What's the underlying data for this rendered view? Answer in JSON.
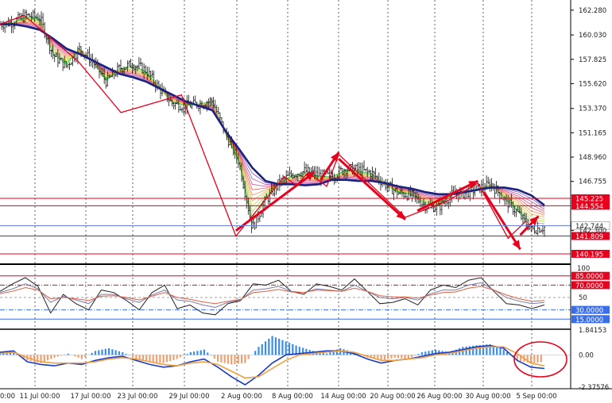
{
  "chart_data": [
    {
      "panel": "price",
      "type": "candlestick",
      "ylim": [
        139.4,
        163.2
      ],
      "y_ticks": [
        "162.280",
        "160.030",
        "157.825",
        "155.620",
        "153.370",
        "151.165",
        "148.960",
        "146.755",
        "142.300"
      ],
      "horizontal_levels": [
        {
          "label": "145.225",
          "value": 145.225,
          "color": "#e8001c",
          "style": "solid"
        },
        {
          "label": "144.554",
          "value": 144.554,
          "color": "#e8001c",
          "style": "solid"
        },
        {
          "label": "141.809",
          "value": 141.809,
          "color": "#e8001c",
          "style": "solid"
        },
        {
          "label": "140.195",
          "value": 140.195,
          "color": "#e8001c",
          "style": "solid"
        }
      ],
      "current_price": {
        "label": "142.744",
        "value": 142.744,
        "color": "#6d7fd6"
      },
      "close_path": [
        161,
        161.2,
        161.8,
        161.6,
        158.2,
        157.2,
        158.8,
        157.6,
        155.8,
        157,
        157.4,
        156.8,
        155.2,
        153.8,
        153.6,
        153.8,
        154.1,
        151,
        148.5,
        142.5,
        145,
        146.6,
        147.4,
        147.7,
        147.3,
        147.2,
        147.9,
        147.8,
        147.5,
        146.5,
        145.7,
        145.5,
        144.6,
        144.4,
        145.5,
        145.7,
        146.1,
        146.5,
        145.1,
        143.9,
        142.4,
        142.6
      ],
      "ma_path": [
        161,
        161,
        160.8,
        160.5,
        159.7,
        158.8,
        158.3,
        157.7,
        157.1,
        156.5,
        156.2,
        155.8,
        155.2,
        154.6,
        154,
        153.6,
        153.2,
        151.3,
        149.7,
        148,
        146.8,
        146.5,
        146.5,
        146.4,
        146.5,
        146.9,
        146.9,
        146.8,
        146.8,
        146.6,
        146.3,
        146.1,
        145.8,
        145.6,
        145.6,
        145.8,
        146,
        146.2,
        146.2,
        146,
        145.5,
        144.6
      ],
      "zigzag": [
        [
          0,
          161
        ],
        [
          4,
          161.8
        ],
        [
          13,
          157.6
        ],
        [
          20,
          153
        ],
        [
          30,
          154.6
        ],
        [
          39,
          141.8
        ],
        [
          47,
          147.2
        ],
        [
          49,
          146.4
        ],
        [
          51,
          147.6
        ],
        [
          54,
          146.3
        ],
        [
          56,
          149.2
        ],
        [
          67,
          143.5
        ],
        [
          74,
          145
        ],
        [
          79,
          146.6
        ],
        [
          84,
          141.6
        ],
        [
          87,
          143.2
        ]
      ],
      "trend_arrows": [
        {
          "from": [
            39,
            142.3
          ],
          "to": [
            52,
            147.6
          ]
        },
        {
          "from": [
            53,
            146.9
          ],
          "to": [
            56,
            149.4
          ]
        },
        {
          "from": [
            56,
            148.8
          ],
          "to": [
            67,
            143.3
          ]
        },
        {
          "from": [
            69,
            144.1
          ],
          "to": [
            79,
            146.8
          ]
        },
        {
          "from": [
            80,
            145.8
          ],
          "to": [
            86,
            140.6
          ]
        },
        {
          "from": [
            86,
            141.9
          ],
          "to": [
            89,
            143.6
          ]
        }
      ]
    },
    {
      "panel": "rsi",
      "type": "line",
      "ylim": [
        0,
        100
      ],
      "y_ticks": [
        "100"
      ],
      "levels": [
        {
          "label": "85.0000",
          "value": 85,
          "color": "#e8001c",
          "style": "solid"
        },
        {
          "label": "70.0000",
          "value": 70,
          "color": "#e8001c",
          "style": "dashdot"
        },
        {
          "label": "50",
          "value": 50,
          "color": "#a0a0a0",
          "style": "dashed"
        },
        {
          "label": "30.0000",
          "value": 30,
          "color": "#3a6ee8",
          "style": "dashdot"
        },
        {
          "label": "15.0000",
          "value": 15,
          "color": "#3a6ee8",
          "style": "solid"
        }
      ],
      "series": [
        {
          "values": [
            60,
            72,
            82,
            68,
            25,
            55,
            40,
            30,
            62,
            58,
            45,
            30,
            58,
            70,
            32,
            38,
            25,
            22,
            40,
            45,
            72,
            70,
            78,
            60,
            55,
            72,
            68,
            62,
            80,
            60,
            40,
            42,
            48,
            38,
            62,
            70,
            66,
            78,
            82,
            60,
            40,
            38,
            32,
            38
          ],
          "color": "#222222"
        },
        {
          "values": [
            58,
            64,
            72,
            64,
            42,
            52,
            46,
            40,
            55,
            55,
            48,
            42,
            54,
            62,
            46,
            44,
            38,
            34,
            42,
            46,
            62,
            64,
            68,
            60,
            58,
            64,
            62,
            60,
            70,
            60,
            50,
            48,
            50,
            46,
            56,
            62,
            62,
            70,
            74,
            62,
            50,
            44,
            40,
            42
          ],
          "color": "#7a7aa8"
        },
        {
          "values": [
            56,
            60,
            66,
            62,
            48,
            50,
            48,
            45,
            52,
            53,
            50,
            46,
            52,
            58,
            50,
            47,
            43,
            40,
            44,
            47,
            58,
            60,
            63,
            59,
            58,
            62,
            61,
            60,
            65,
            60,
            53,
            51,
            51,
            49,
            54,
            58,
            59,
            65,
            68,
            62,
            54,
            48,
            44,
            45
          ],
          "color": "#e06040"
        }
      ]
    },
    {
      "panel": "macd",
      "type": "bar+line",
      "ylim": [
        -2.37576,
        1.84153
      ],
      "y_ticks": [
        "1.84153",
        "0.00",
        "-2.37576"
      ],
      "histogram": [
        0.2,
        0.3,
        -0.4,
        -0.6,
        -0.2,
        0.1,
        -0.3,
        0.3,
        0.5,
        0.2,
        -0.3,
        -0.5,
        -0.6,
        -0.3,
        0.2,
        0.4,
        -0.5,
        -0.7,
        -0.6,
        0.6,
        1.4,
        1.0,
        0.6,
        0.3,
        0.1,
        0.5,
        0.2,
        -0.2,
        -0.4,
        -0.2,
        -0.3,
        0.2,
        0.4,
        0.2,
        0.6,
        0.7,
        0.8,
        0.4,
        -0.4,
        -0.6,
        -0.5
      ],
      "series": [
        {
          "values": [
            0.2,
            0.3,
            -0.5,
            -0.7,
            -0.8,
            -0.6,
            -0.7,
            -0.4,
            -0.2,
            -0.1,
            -0.4,
            -0.7,
            -0.9,
            -0.8,
            -0.5,
            -0.3,
            -0.9,
            -1.6,
            -2.2,
            -1.5,
            -0.6,
            0,
            0.1,
            0.2,
            0.3,
            0.3,
            0.1,
            -0.3,
            -0.6,
            -0.4,
            -0.3,
            -0.1,
            0.1,
            0.2,
            0.4,
            0.6,
            0.7,
            0.5,
            -0.4,
            -0.9,
            -1.0
          ],
          "color": "#1a3cc8"
        },
        {
          "values": [
            0.1,
            0.2,
            -0.2,
            -0.5,
            -0.6,
            -0.6,
            -0.6,
            -0.5,
            -0.3,
            -0.2,
            -0.3,
            -0.5,
            -0.7,
            -0.8,
            -0.6,
            -0.5,
            -0.7,
            -1.2,
            -1.7,
            -1.6,
            -1.0,
            -0.4,
            0,
            0.1,
            0.2,
            0.3,
            0.2,
            -0.1,
            -0.4,
            -0.4,
            -0.3,
            -0.2,
            0,
            0.1,
            0.3,
            0.5,
            0.6,
            0.6,
            0.1,
            -0.6,
            -0.8
          ],
          "color": "#f0a040"
        }
      ]
    }
  ],
  "x_axis": {
    "tick_labels": [
      "0:00",
      "11 Jul 00:00",
      "17 Jul 00:00",
      "23 Jul 00:00",
      "29 Jul 00:00",
      "2 Aug 00:00",
      "8 Aug 00:00",
      "14 Aug 00:00",
      "20 Aug 00:00",
      "26 Aug 00:00",
      "30 Aug 00:00",
      "5 Sep 00:00"
    ]
  },
  "highlight_circle": {
    "panel": "macd",
    "color": "#e8001c"
  },
  "colors": {
    "level": "#e8001c",
    "ma": "#1a237e",
    "zigzag": "#e8001c",
    "price_line": "#6d7fd6",
    "hist_up": "#3b8ee8",
    "hist_down": "#f0a070"
  }
}
